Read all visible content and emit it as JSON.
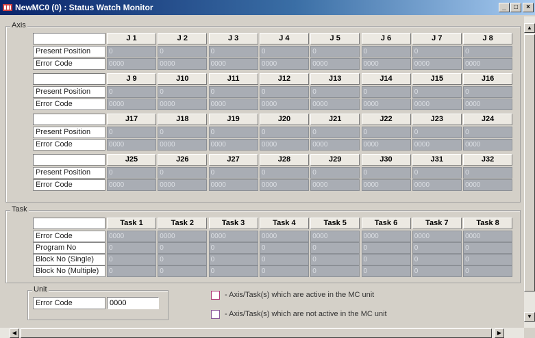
{
  "window": {
    "title": "NewMC0 (0) : Status Watch Monitor",
    "minimize_label": "_",
    "maximize_label": "□",
    "close_label": "×"
  },
  "axis": {
    "legend": "Axis",
    "row_labels": [
      "Present Position",
      "Error Code"
    ],
    "blocks": [
      {
        "headers": [
          "J 1",
          "J 2",
          "J 3",
          "J 4",
          "J 5",
          "J 6",
          "J 7",
          "J 8"
        ],
        "present": [
          "0",
          "0",
          "0",
          "0",
          "0",
          "0",
          "0",
          "0"
        ],
        "error": [
          "0000",
          "0000",
          "0000",
          "0000",
          "0000",
          "0000",
          "0000",
          "0000"
        ]
      },
      {
        "headers": [
          "J 9",
          "J10",
          "J11",
          "J12",
          "J13",
          "J14",
          "J15",
          "J16"
        ],
        "present": [
          "0",
          "0",
          "0",
          "0",
          "0",
          "0",
          "0",
          "0"
        ],
        "error": [
          "0000",
          "0000",
          "0000",
          "0000",
          "0000",
          "0000",
          "0000",
          "0000"
        ]
      },
      {
        "headers": [
          "J17",
          "J18",
          "J19",
          "J20",
          "J21",
          "J22",
          "J23",
          "J24"
        ],
        "present": [
          "0",
          "0",
          "0",
          "0",
          "0",
          "0",
          "0",
          "0"
        ],
        "error": [
          "0000",
          "0000",
          "0000",
          "0000",
          "0000",
          "0000",
          "0000",
          "0000"
        ]
      },
      {
        "headers": [
          "J25",
          "J26",
          "J27",
          "J28",
          "J29",
          "J30",
          "J31",
          "J32"
        ],
        "present": [
          "0",
          "0",
          "0",
          "0",
          "0",
          "0",
          "0",
          "0"
        ],
        "error": [
          "0000",
          "0000",
          "0000",
          "0000",
          "0000",
          "0000",
          "0000",
          "0000"
        ]
      }
    ]
  },
  "task": {
    "legend": "Task",
    "headers": [
      "Task 1",
      "Task 2",
      "Task 3",
      "Task 4",
      "Task 5",
      "Task 6",
      "Task 7",
      "Task 8"
    ],
    "rows": [
      {
        "label": "Error Code",
        "values": [
          "0000",
          "0000",
          "0000",
          "0000",
          "0000",
          "0000",
          "0000",
          "0000"
        ]
      },
      {
        "label": "Program No",
        "values": [
          "0",
          "0",
          "0",
          "0",
          "0",
          "0",
          "0",
          "0"
        ]
      },
      {
        "label": "Block No (Single)",
        "values": [
          "0",
          "0",
          "0",
          "0",
          "0",
          "0",
          "0",
          "0"
        ]
      },
      {
        "label": "Block No (Multiple)",
        "values": [
          "0",
          "0",
          "0",
          "0",
          "0",
          "0",
          "0",
          "0"
        ]
      }
    ]
  },
  "unit": {
    "legend": "Unit",
    "error_code_label": "Error Code",
    "error_code_value": "0000"
  },
  "legend": {
    "active_text": "- Axis/Task(s) which are active in the MC unit",
    "inactive_text": "- Axis/Task(s) which are not active in the MC unit",
    "active_color": "#b03a78",
    "inactive_color": "#8a5a9a"
  },
  "scrollbar": {
    "up_arrow": "▲",
    "down_arrow": "▼",
    "left_arrow": "◀",
    "right_arrow": "▶"
  }
}
